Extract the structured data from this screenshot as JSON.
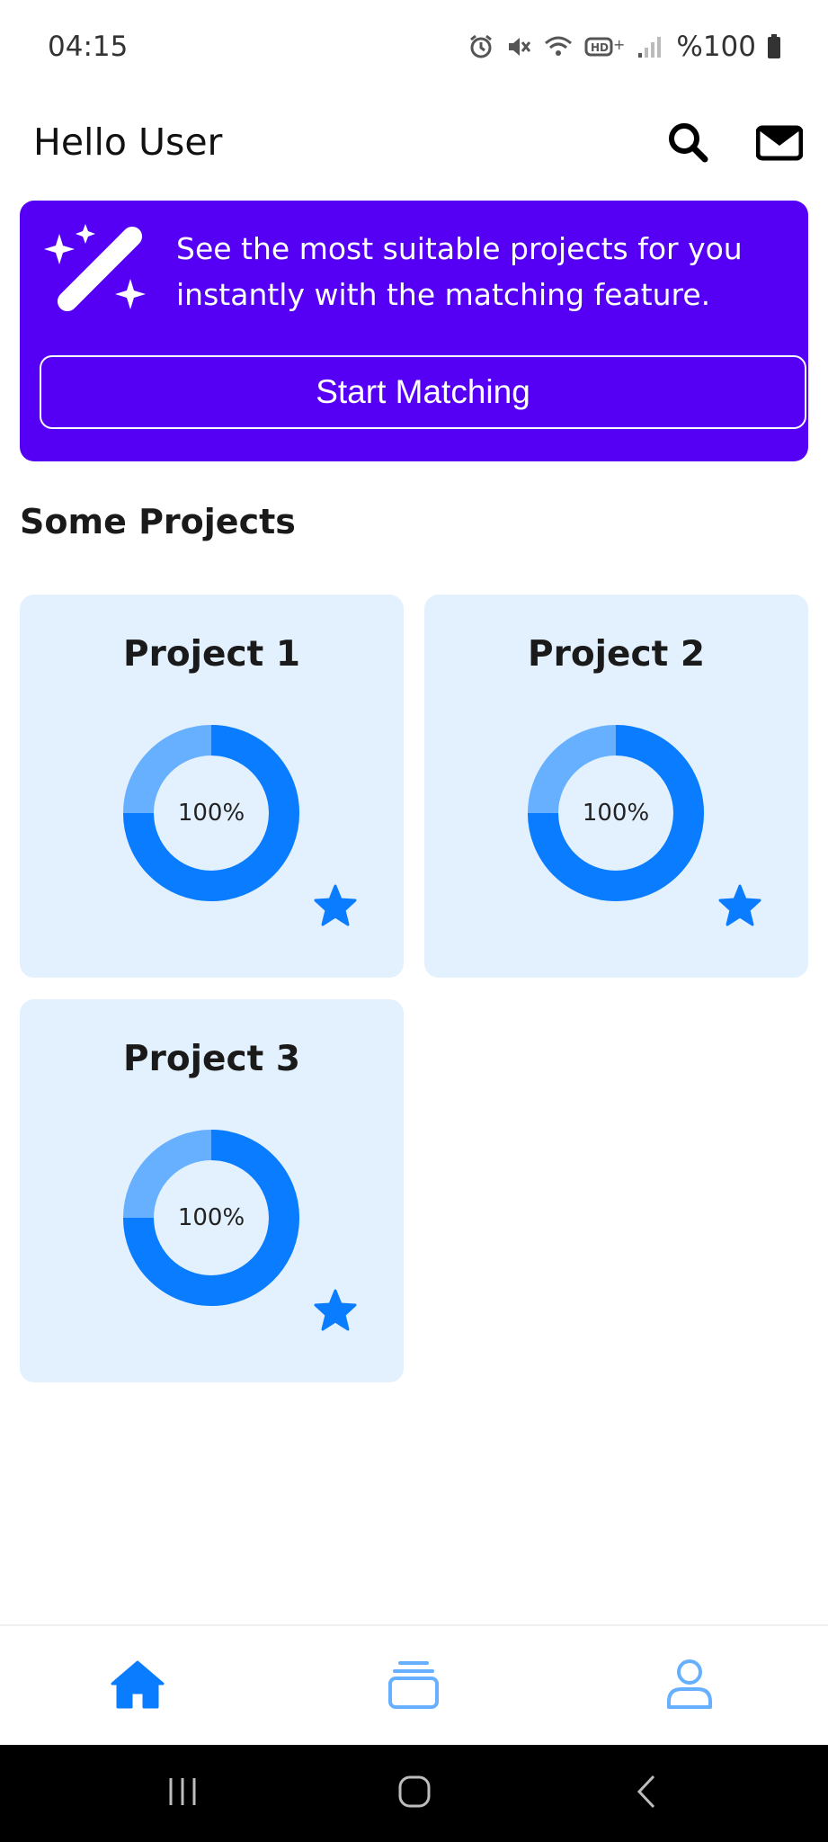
{
  "status_bar": {
    "time": "04:15",
    "battery": "%100",
    "icons": [
      "alarm-icon",
      "mute-icon",
      "wifi-icon",
      "hd-plus-icon",
      "signal-icon",
      "battery-icon"
    ]
  },
  "header": {
    "greeting": "Hello User",
    "icons": [
      "search-icon",
      "mail-icon"
    ]
  },
  "promo": {
    "text": "See the most suitable projects for you instantly with the matching feature.",
    "button_label": "Start Matching",
    "icon": "magic-wand-icon",
    "background_color": "#5500f5"
  },
  "section_title": "Some Projects",
  "projects": [
    {
      "title": "Project 1",
      "progress": 100,
      "progress_label": "100%",
      "favorite": true
    },
    {
      "title": "Project 2",
      "progress": 100,
      "progress_label": "100%",
      "favorite": true
    },
    {
      "title": "Project 3",
      "progress": 100,
      "progress_label": "100%",
      "favorite": true
    }
  ],
  "bottom_nav": {
    "items": [
      {
        "icon": "home-icon",
        "active": true
      },
      {
        "icon": "projects-stack-icon",
        "active": false
      },
      {
        "icon": "profile-icon",
        "active": false
      }
    ]
  },
  "colors": {
    "accent": "#0a7cff",
    "accent_light": "#66b0ff",
    "card_background": "#e3f0fd",
    "promo": "#5500f5"
  }
}
